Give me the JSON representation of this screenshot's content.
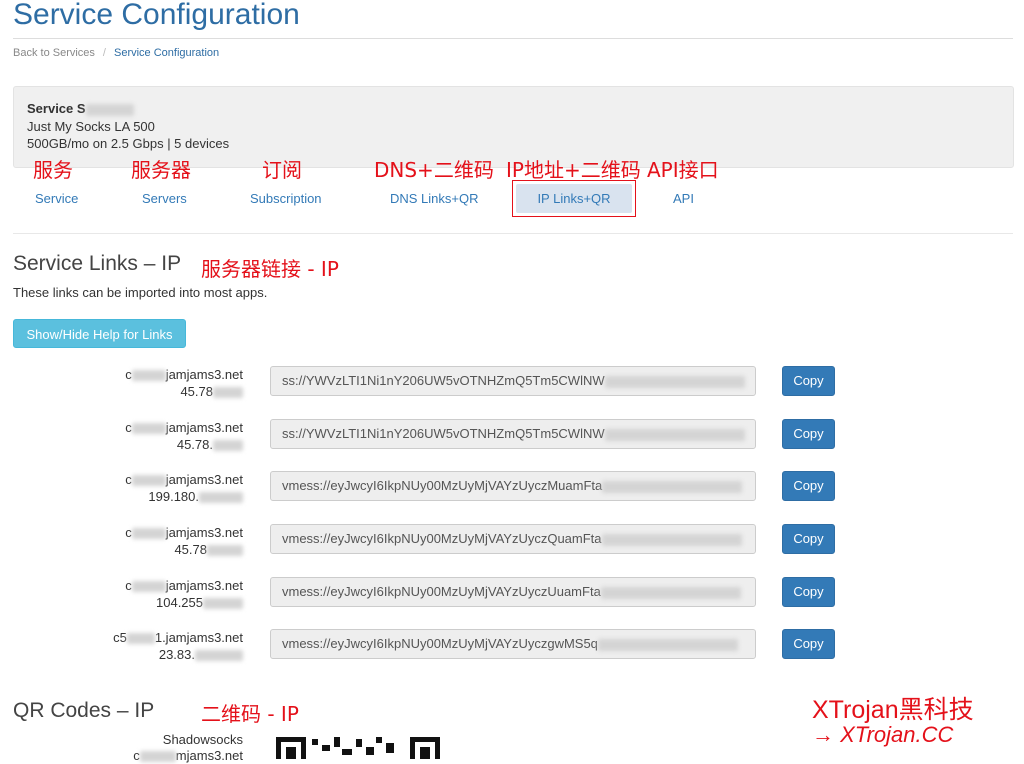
{
  "page": {
    "title": "Service Configuration"
  },
  "breadcrumb": {
    "back": "Back to Services",
    "separator": "/",
    "current": "Service Configuration"
  },
  "service": {
    "name": "Service S",
    "plan": "Just My Socks LA 500",
    "details": "500GB/mo on 2.5 Gbps | 5 devices"
  },
  "tabs": [
    {
      "label": "Service",
      "annotation": "服务"
    },
    {
      "label": "Servers",
      "annotation": "服务器"
    },
    {
      "label": "Subscription",
      "annotation": "订阅"
    },
    {
      "label": "DNS Links+QR",
      "annotation": "DNS+二维码"
    },
    {
      "label": "IP Links+QR",
      "annotation": "IP地址+二维码",
      "active": true
    },
    {
      "label": "API",
      "annotation": "API接口"
    }
  ],
  "links_section": {
    "title": "Service Links – IP",
    "annotation": "服务器链接 - IP",
    "subtitle": "These links can be imported into most apps.",
    "help_button": "Show/Hide Help for Links",
    "copy_label": "Copy",
    "rows": [
      {
        "host_prefix": "c",
        "host_suffix": "jamjams3.net",
        "ip": "45.78",
        "link": "ss://YWVzLTI1Ni1nY206UW5vOTNHZmQ5Tm5CWlNW"
      },
      {
        "host_prefix": "c",
        "host_suffix": "jamjams3.net",
        "ip": "45.78.",
        "link": "ss://YWVzLTI1Ni1nY206UW5vOTNHZmQ5Tm5CWlNW"
      },
      {
        "host_prefix": "c",
        "host_suffix": "jamjams3.net",
        "ip": "199.180.",
        "link": "vmess://eyJwcyI6IkpNUy00MzUyMjVAYzUyczMuamFta"
      },
      {
        "host_prefix": "c",
        "host_suffix": "jamjams3.net",
        "ip": "45.78",
        "link": "vmess://eyJwcyI6IkpNUy00MzUyMjVAYzUyczQuamFta"
      },
      {
        "host_prefix": "c",
        "host_suffix": "jamjams3.net",
        "ip": "104.255",
        "link": "vmess://eyJwcyI6IkpNUy00MzUyMjVAYzUyczUuamFta"
      },
      {
        "host_prefix": "c5",
        "host_suffix": "1.jamjams3.net",
        "ip": "23.83.",
        "link": "vmess://eyJwcyI6IkpNUy00MzUyMjVAYzUyczgwMS5q"
      }
    ]
  },
  "qr_section": {
    "title": "QR Codes – IP",
    "annotation": "二维码 - IP",
    "first_label": "Shadowsocks",
    "first_host_fragment": "c",
    "first_host_suffix": "mjams3.net"
  },
  "watermark": {
    "line1": "XTrojan黑科技",
    "line2": "→ XTrojan.CC"
  },
  "colors": {
    "link": "#337ab7",
    "annotation": "#e4111a",
    "info_button": "#5bc0de",
    "primary_button": "#337ab7"
  }
}
